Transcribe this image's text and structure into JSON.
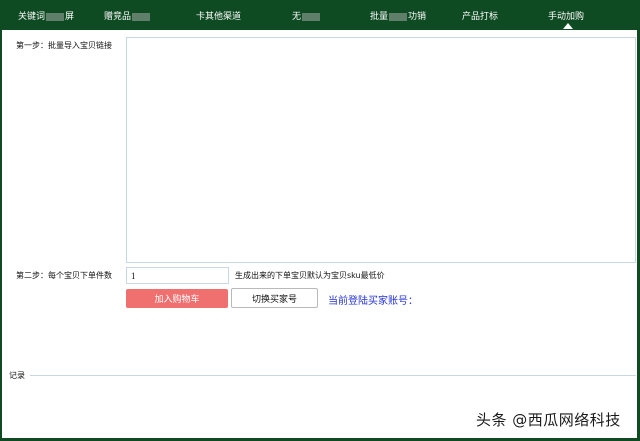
{
  "nav": {
    "items": [
      {
        "pre": "关键词",
        "post": "屏",
        "blurred": true
      },
      {
        "pre": "赠竞品",
        "post": "",
        "blurred": true
      },
      {
        "pre": "卡其他渠道",
        "post": "",
        "blurred": false
      },
      {
        "pre": "无",
        "post": "",
        "blurred": true
      },
      {
        "pre": "批量",
        "post": "功销",
        "blurred": true
      },
      {
        "pre": "产品打标",
        "post": "",
        "blurred": false
      },
      {
        "pre": "手动加购",
        "post": "",
        "blurred": false,
        "active": true
      }
    ]
  },
  "step1": {
    "label": "第一步：批量导入宝贝链接",
    "value": ""
  },
  "step2": {
    "label": "第二步：每个宝贝下单件数",
    "qty_value": "1",
    "hint": "生成出来的下单宝贝默认为宝贝sku最低价"
  },
  "buttons": {
    "add_cart": "加入购物车",
    "switch_account": "切换买家号"
  },
  "account": {
    "label": "当前登陆买家账号："
  },
  "record": {
    "label": "记录"
  },
  "watermark": {
    "text": "头条 @西瓜网络科技"
  },
  "colors": {
    "nav_bg": "#0e4a22",
    "add_cart_bg": "#f07070",
    "account_text": "#2432d6"
  }
}
